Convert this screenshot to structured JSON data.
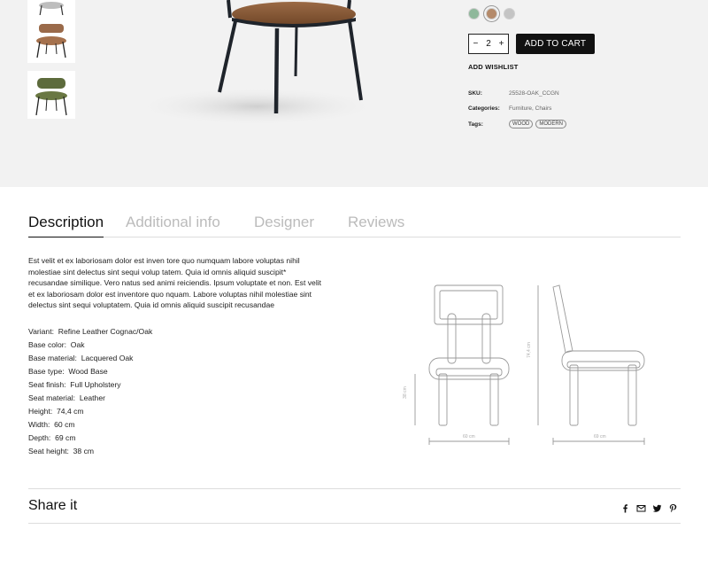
{
  "colors": {
    "swatches": [
      "#8fb89b",
      "#b48a6a",
      "#c4c4c4"
    ],
    "selected_swatch": 1
  },
  "quantity": {
    "minus": "−",
    "value": "2",
    "plus": "+"
  },
  "add_to_cart": "ADD TO CART",
  "add_wishlist": "ADD WISHLIST",
  "meta": {
    "sku_label": "SKU:",
    "sku_value": "25528-OAK_CCGN",
    "categories_label": "Categories:",
    "categories_value": "Furniture, Chairs",
    "tags_label": "Tags:",
    "tags": [
      "WOOD",
      "MODERN"
    ]
  },
  "tabs": [
    "Description",
    "Additional info",
    "Designer",
    "Reviews"
  ],
  "active_tab": "Description",
  "description": "Est velit et ex laboriosam dolor est inven tore quo numquam labore voluptas nihil molestiae sint delectus sint sequi volup tatem. Quia id omnis aliquid suscipit* recusandae similique. Vero natus sed animi reiciendis. Ipsum voluptate et non. Est velit et ex laboriosam dolor est inventore quo nquam. Labore voluptas nihil molestiae sint delectus sint sequi voluptatem. Quia id omnis aliquid suscipit recusandae",
  "specs": [
    {
      "label": "Variant:",
      "value": "Refine Leather Cognac/Oak"
    },
    {
      "label": "Base color:",
      "value": "Oak"
    },
    {
      "label": "Base material:",
      "value": "Lacquered Oak"
    },
    {
      "label": "Base type:",
      "value": "Wood Base"
    },
    {
      "label": "Seat finish:",
      "value": "Full Upholstery"
    },
    {
      "label": "Seat material:",
      "value": "Leather"
    },
    {
      "label": "Height:",
      "value": "74,4 cm"
    },
    {
      "label": "Width:",
      "value": "60 cm"
    },
    {
      "label": "Depth:",
      "value": "69 cm"
    },
    {
      "label": "Seat height:",
      "value": "38 cm"
    }
  ],
  "diagram_labels": {
    "seat_height": "38 cm",
    "height": "74,4 cm",
    "width": "60 cm",
    "depth": "69 cm"
  },
  "share": {
    "title": "Share it",
    "icons": [
      "facebook-icon",
      "mail-icon",
      "twitter-icon",
      "pinterest-icon"
    ]
  }
}
